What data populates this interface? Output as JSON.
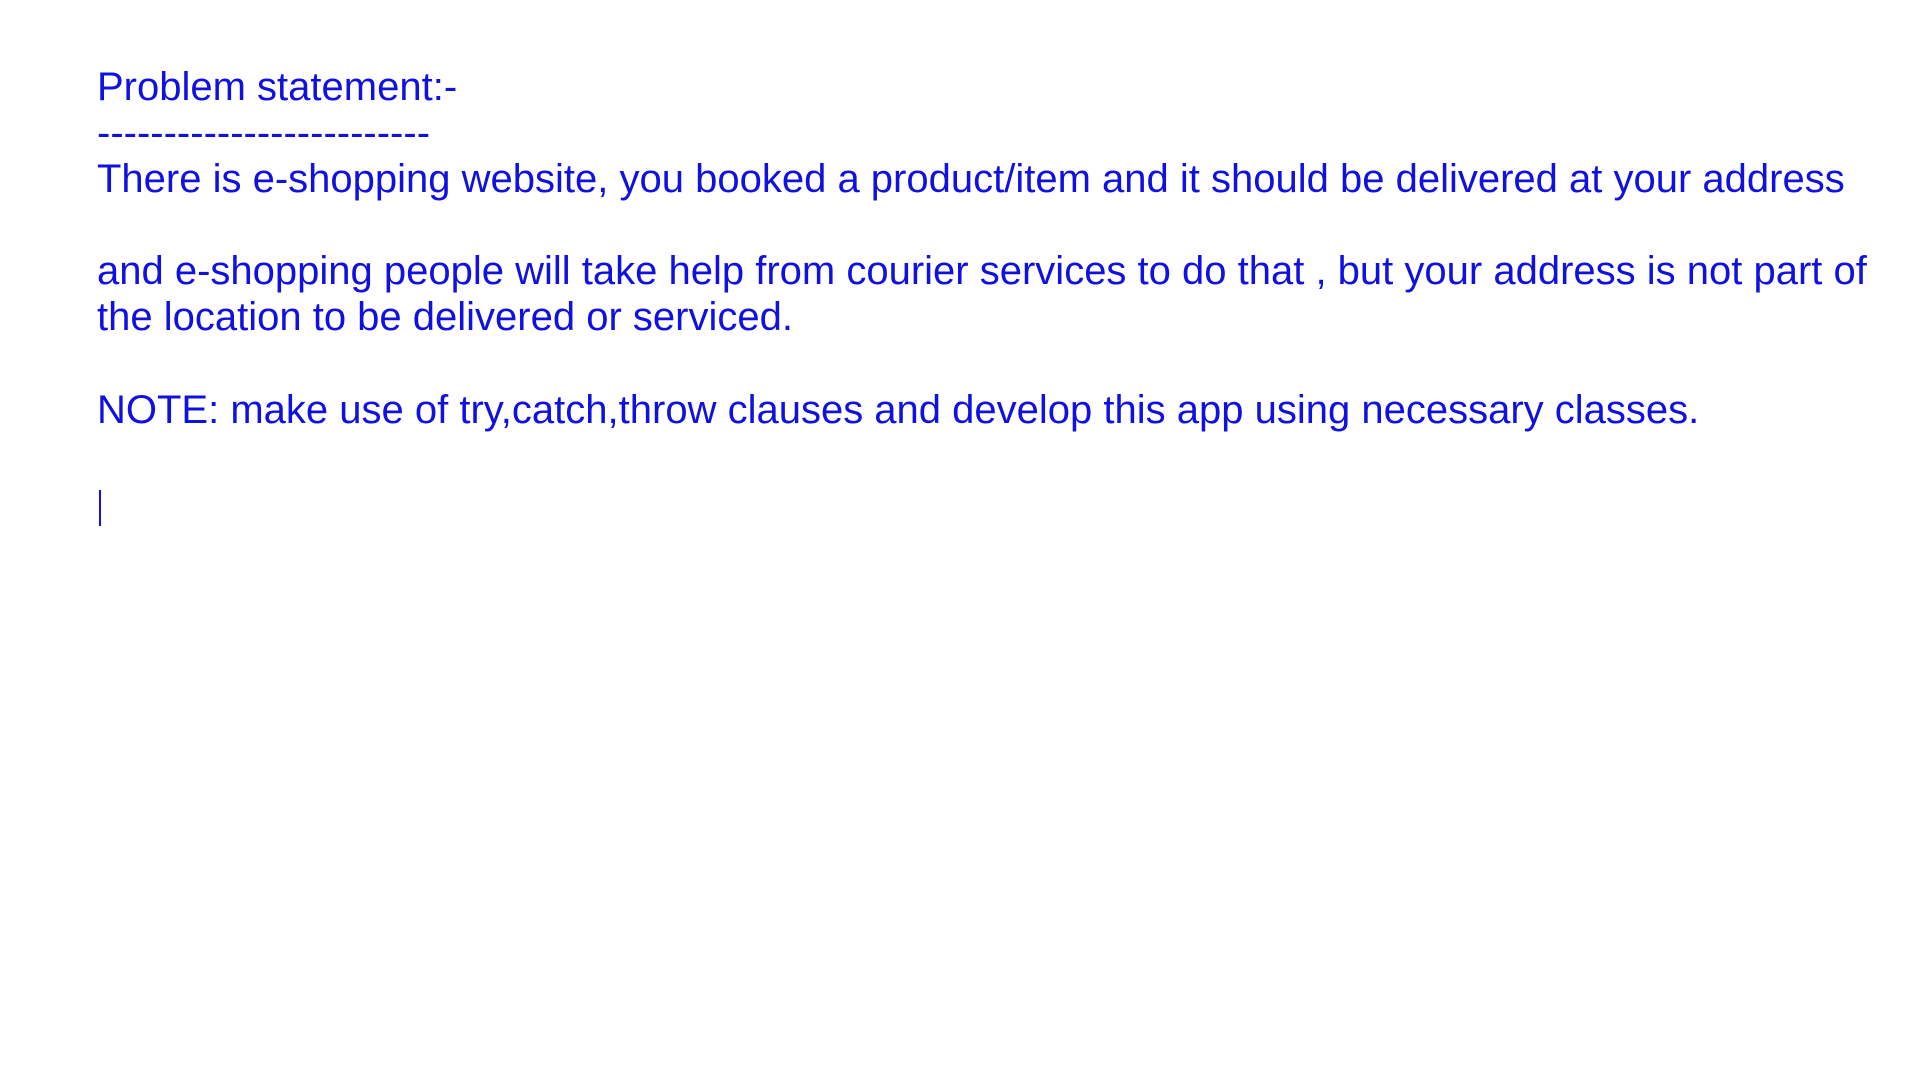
{
  "document": {
    "title": "Problem statement:-",
    "rule": "-------------------------",
    "paragraph1": "There is e-shopping website, you booked a product/item and it should be delivered at your address",
    "paragraph2_line1": "and e-shopping people will take help from courier services to do that , but your address is not part of",
    "paragraph2_line2": "the location to be delivered or serviced.",
    "note": "NOTE: make use of try,catch,throw clauses and develop this app using necessary classes.",
    "text_color": "#1010e0"
  }
}
